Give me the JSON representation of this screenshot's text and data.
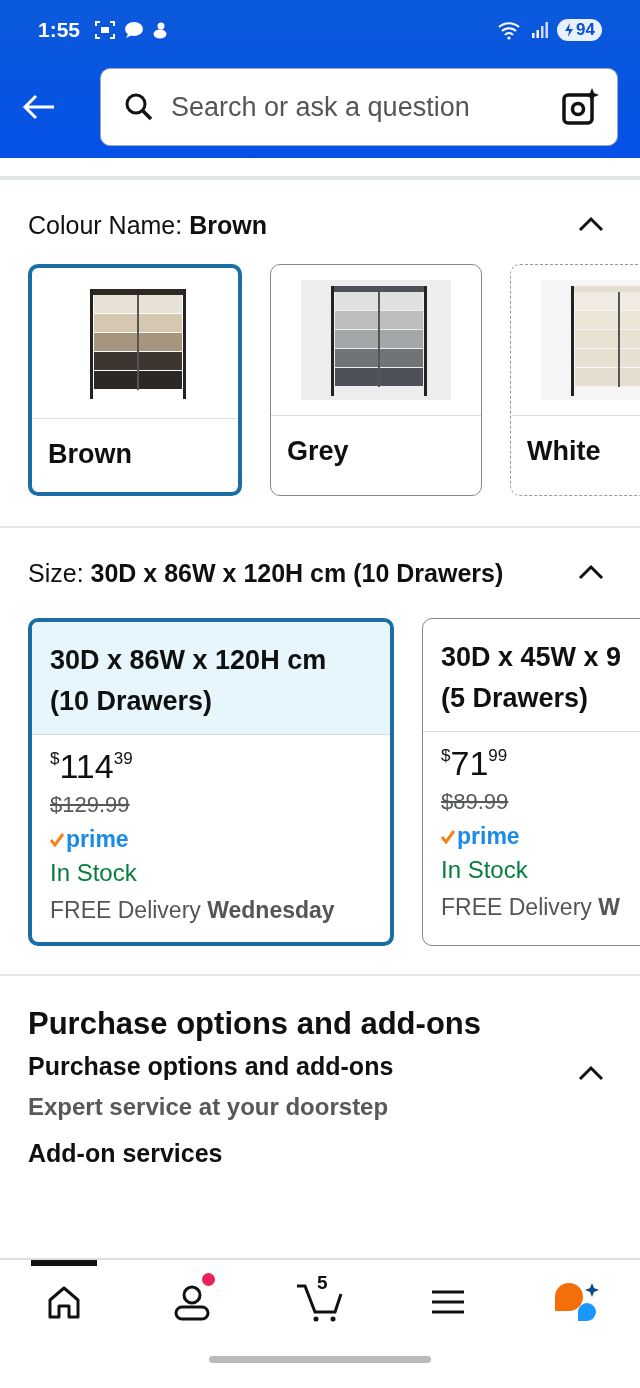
{
  "status_bar": {
    "time": "1:55",
    "battery": "94"
  },
  "search": {
    "placeholder": "Search or ask a question"
  },
  "colour": {
    "label": "Colour Name:",
    "value": "Brown",
    "expanded": true,
    "options": [
      {
        "name": "Brown",
        "selected": true,
        "available": true
      },
      {
        "name": "Grey",
        "selected": false,
        "available": true
      },
      {
        "name": "White",
        "selected": false,
        "available": false
      }
    ]
  },
  "size": {
    "label": "Size:",
    "value": "30D x 86W x 120H cm (10 Drawers)",
    "expanded": true,
    "options": [
      {
        "title_lines": [
          "30D x 86W x 120H cm",
          "(10 Drawers)"
        ],
        "currency": "$",
        "whole": "114",
        "fraction": "39",
        "list_price": "$129.99",
        "prime": true,
        "prime_label": "prime",
        "stock": "In Stock",
        "delivery": "FREE Delivery",
        "delivery_day": "Wednesday",
        "selected": true
      },
      {
        "title_lines": [
          "30D x 45W x 9",
          "(5 Drawers)"
        ],
        "currency": "$",
        "whole": "71",
        "fraction": "99",
        "list_price": "$89.99",
        "prime": true,
        "prime_label": "prime",
        "stock": "In Stock",
        "delivery": "FREE Delivery",
        "delivery_day": "W",
        "selected": false
      }
    ]
  },
  "purchase": {
    "heading": "Purchase options and add-ons",
    "subheading": "Purchase options and add-ons",
    "expanded": true,
    "description": "Expert service at your doorstep",
    "addon_label": "Add-on services"
  },
  "bottom_nav": [
    {
      "kind": "home",
      "selected": true
    },
    {
      "kind": "account",
      "selected": false,
      "notification": true
    },
    {
      "kind": "cart",
      "selected": false,
      "count": "5"
    },
    {
      "kind": "menu",
      "selected": false
    },
    {
      "kind": "assistant",
      "selected": false
    }
  ]
}
